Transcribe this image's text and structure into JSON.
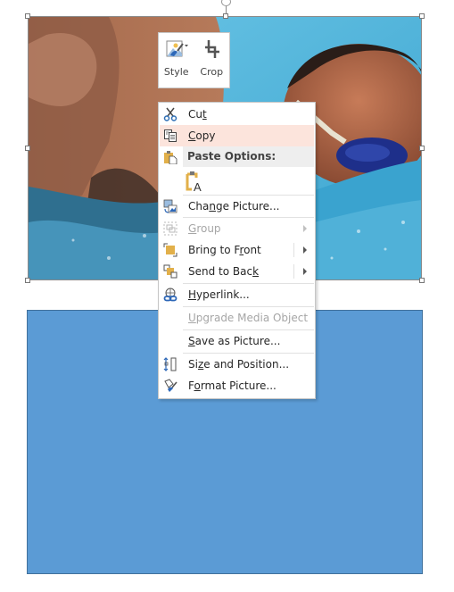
{
  "canvas": {
    "picture": {
      "description": "Swimmer with goggles in pool",
      "selected": true
    },
    "shape": {
      "type": "rectangle",
      "fill": "#5b9bd5",
      "outline": "#41719c"
    }
  },
  "mini_toolbar": {
    "buttons": [
      {
        "label": "Style",
        "icon": "picture-style-icon"
      },
      {
        "label": "Crop",
        "icon": "crop-icon"
      }
    ]
  },
  "context_menu": {
    "highlight_color": "#fce4dc",
    "items": [
      {
        "id": "cut",
        "pre": "Cu",
        "acc": "t",
        "post": "",
        "icon": "scissors-icon",
        "enabled": true
      },
      {
        "id": "copy",
        "pre": "",
        "acc": "C",
        "post": "opy",
        "icon": "copy-icon",
        "enabled": true,
        "highlighted": true
      },
      {
        "id": "paste-options",
        "label": "Paste Options:",
        "icon": "paste-icon",
        "header": true
      },
      {
        "id": "paste-keep-text",
        "icon": "paste-text-only-icon"
      },
      {
        "id": "change-picture",
        "pre": "Cha",
        "acc": "n",
        "post": "ge Picture...",
        "icon": "change-picture-icon",
        "enabled": true
      },
      {
        "id": "group",
        "pre": "",
        "acc": "G",
        "post": "roup",
        "icon": "group-icon",
        "enabled": false,
        "submenu": true
      },
      {
        "id": "bring-to-front",
        "pre": "Bring to F",
        "acc": "r",
        "post": "ont",
        "icon": "bring-to-front-icon",
        "enabled": true,
        "submenu": true
      },
      {
        "id": "send-to-back",
        "pre": "Send to Bac",
        "acc": "k",
        "post": "",
        "icon": "send-to-back-icon",
        "enabled": true,
        "submenu": true
      },
      {
        "id": "hyperlink",
        "pre": "",
        "acc": "H",
        "post": "yperlink...",
        "icon": "hyperlink-icon",
        "enabled": true
      },
      {
        "id": "upgrade-media",
        "pre": "",
        "acc": "U",
        "post": "pgrade Media Object",
        "enabled": false
      },
      {
        "id": "save-as-picture",
        "pre": "",
        "acc": "S",
        "post": "ave as Picture...",
        "enabled": true
      },
      {
        "id": "size-position",
        "pre": "Si",
        "acc": "z",
        "post": "e and Position...",
        "icon": "size-position-icon",
        "enabled": true
      },
      {
        "id": "format-picture",
        "pre": "F",
        "acc": "o",
        "post": "rmat Picture...",
        "icon": "format-picture-icon",
        "enabled": true
      }
    ]
  }
}
